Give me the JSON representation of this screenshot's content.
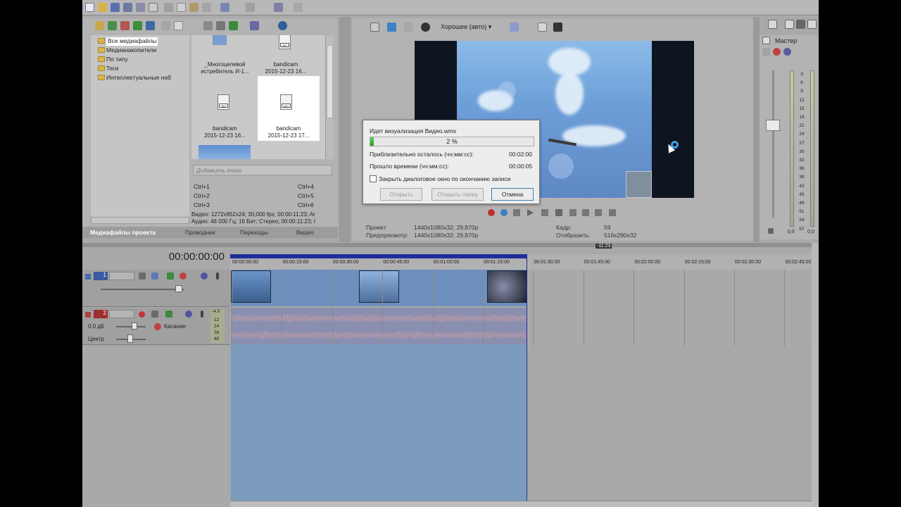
{
  "explorer": {
    "tree": [
      "Все медиафайлы",
      "Медианакопители",
      "По типу",
      "Теги",
      "Интеллектуальные наб"
    ],
    "media": [
      {
        "name": "_Многоцелевой",
        "line2": "истребитель И-1..."
      },
      {
        "name": "bandicam",
        "line2": "2015-12-23 16..."
      },
      {
        "name": "bandicam",
        "line2": "2015-12-23 16..."
      },
      {
        "name": "bandicam",
        "line2": "2015-12-23 17..."
      }
    ],
    "file_badge": "AVI",
    "tag_placeholder": "Добавить теги",
    "shortcuts_left": [
      "Ctrl+1",
      "Ctrl+2",
      "Ctrl+3"
    ],
    "shortcuts_right": [
      "Ctrl+4",
      "Ctrl+5",
      "Ctrl+6"
    ],
    "info_line1": "Видео: 1272x952x24; 30,000 fps; 00:00:11:23; Ar",
    "info_line2": "Аудио: 48 000 Гц; 16 Бит; Стерео; 00:00:11:23; I",
    "tabs": [
      "Медиафайлы проекта",
      "Проводник",
      "Переходы",
      "Видео"
    ]
  },
  "preview": {
    "quality": "Хорошее (авто)",
    "project_label": "Проект:",
    "project_value": "1440x1080x32; 29,970p",
    "preproject_label": "Предпросмотр:",
    "preproject_value": "1440x1080x32; 29,970p",
    "frame_label": "Кадр:",
    "frame_value": "59",
    "display_label": "Отобразить:",
    "display_value": "516x290x32"
  },
  "dialog": {
    "title": "Идет визуализация Видео.wmv",
    "progress": 0.02,
    "progress_text": "2 %",
    "remain_label": "Приблизительно осталось (чч:мм:сс):",
    "remain_value": "00:02:00",
    "elapsed_label": "Прошло времени (чч:мм:сс):",
    "elapsed_value": "00:00:05",
    "checkbox_label": "Закрыть диалоговое окно по окончанию записи",
    "btn_open": "Открыть",
    "btn_open_folder": "Открыть папку",
    "btn_cancel": "Отмена"
  },
  "master": {
    "title": "Мастер",
    "scale": [
      "3",
      "6",
      "9",
      "12",
      "15",
      "18",
      "21",
      "24",
      "27",
      "30",
      "33",
      "36",
      "39",
      "42",
      "45",
      "48",
      "51",
      "54",
      "57"
    ],
    "left_value": "0,0",
    "right_value": "0,0"
  },
  "timeline": {
    "timecode": "00:00:00:00",
    "duration_badge": "-11:23",
    "ruler": [
      "00:00:00:00",
      "00:00:15:00",
      "00:00:30:00",
      "00:00:45:00",
      "00:01:00:00",
      "00:01:15:00",
      "00:01:30:00",
      "00:01:45:00",
      "00:02:00:00",
      "00:02:15:00",
      "00:02:30:00",
      "00:02:45:00"
    ],
    "video_track_no": "1",
    "audio_track_no": "2",
    "audio_db": "0,0 дБ",
    "audio_pan": "Центр",
    "audio_mode": "Касание",
    "audio_meter": [
      "-4.9",
      "12",
      "24",
      "36",
      "48"
    ]
  }
}
